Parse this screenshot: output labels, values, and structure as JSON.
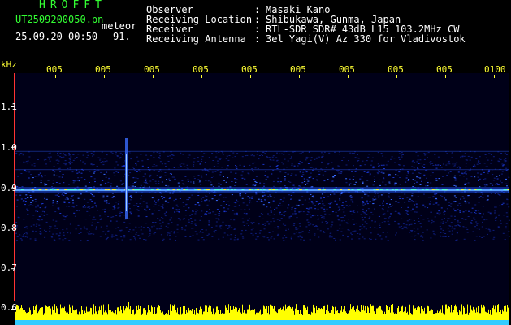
{
  "header": {
    "title": "HROFFT",
    "filename": "UT2509200050.pn",
    "kind": "meteor",
    "datetime": "25.09.20 00:50",
    "value": "91."
  },
  "info": [
    {
      "label": "Observer",
      "value": "Masaki Kano"
    },
    {
      "label": "Receiving Location",
      "value": "Shibukawa, Gunma, Japan"
    },
    {
      "label": "Receiver",
      "value": "RTL-SDR SDR# 43dB L15 103.2MHz CW"
    },
    {
      "label": "Receiving Antenna",
      "value": "3el Yagi(V) Az 330 for Vladivostok"
    }
  ],
  "info_colon": ":",
  "chart_data": {
    "type": "heatmap",
    "ylabel": "kHz",
    "y_ticks": [
      "1.1",
      "1.0",
      "0.9",
      "0.8",
      "0.7",
      "0.6"
    ],
    "x_ticks": [
      "005",
      "005",
      "005",
      "005",
      "005",
      "005",
      "005",
      "005",
      "005",
      "0100"
    ],
    "ylim": [
      0.6,
      1.1
    ],
    "main_signal_khz": 0.895,
    "band_khz": [
      0.77,
      0.99
    ],
    "colors": {
      "background": "#000020",
      "signal": "#ffee33",
      "baseline": "#ff3333",
      "amplitude": "#ffff00",
      "amplitude_base": "#33ccff"
    }
  }
}
